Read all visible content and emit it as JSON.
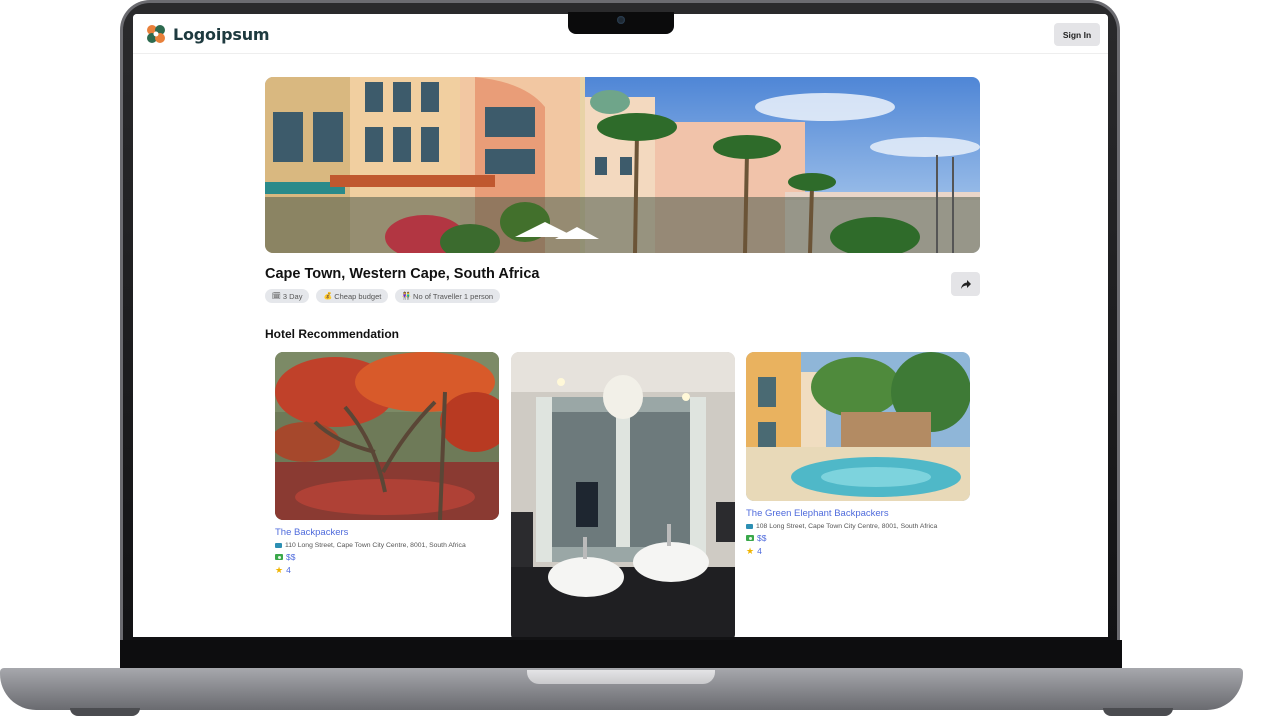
{
  "app": {
    "logo_text": "Logoipsum",
    "sign_in_label": "Sign In"
  },
  "trip": {
    "title": "Cape Town, Western Cape, South Africa",
    "chips": [
      {
        "icon": "calendar-icon",
        "label": "3 Day"
      },
      {
        "icon": "money-bag-icon",
        "label": "Cheap budget"
      },
      {
        "icon": "people-icon",
        "label": "No of Traveller 1 person"
      }
    ]
  },
  "hotels": {
    "section_title": "Hotel Recommendation",
    "items": [
      {
        "name": "The Backpackers",
        "address": "110 Long Street, Cape Town City Centre, 8001, South Africa",
        "price": "$$",
        "rating": "4"
      },
      {
        "name": "",
        "address": "",
        "price": "",
        "rating": ""
      },
      {
        "name": "The Green Elephant Backpackers",
        "address": "108 Long Street, Cape Town City Centre, 8001, South Africa",
        "price": "$$",
        "rating": "4"
      }
    ]
  },
  "colors": {
    "link_blue": "#4f6bdc",
    "button_gray": "#e4e4e7",
    "logo_orange": "#e8803a",
    "logo_green": "#2d6a4f"
  }
}
